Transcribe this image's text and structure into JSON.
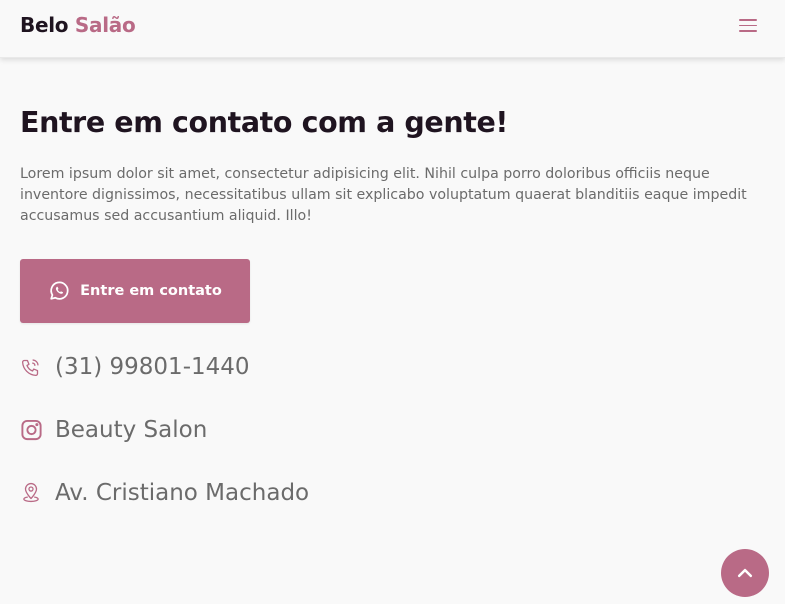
{
  "header": {
    "logo_first": "Belo",
    "logo_second": "Salão",
    "menu_icon": "hamburger-menu-icon"
  },
  "main": {
    "title": "Entre em contato com a gente!",
    "description": "Lorem ipsum dolor sit amet, consectetur adipisicing elit. Nihil culpa porro doloribus officiis neque inventore dignissimos, necessitatibus ullam sit explicabo voluptatum quaerat blanditiis eaque impedit accusamus sed accusantium aliquid. Illo!",
    "contact_button": {
      "label": "Entre em contato",
      "icon": "whatsapp-icon"
    }
  },
  "contact_info": {
    "phone": {
      "icon": "phone-icon",
      "text": "(31) 99801-1440"
    },
    "instagram": {
      "icon": "instagram-icon",
      "text": "Beauty Salon"
    },
    "address": {
      "icon": "location-pin-icon",
      "text": "Av. Cristiano Machado"
    }
  },
  "scroll_top": {
    "icon": "chevron-up-icon"
  },
  "colors": {
    "accent": "#b96a86",
    "heading": "#1f1420",
    "text": "#6b6b6b",
    "background": "#f9f9f9"
  }
}
